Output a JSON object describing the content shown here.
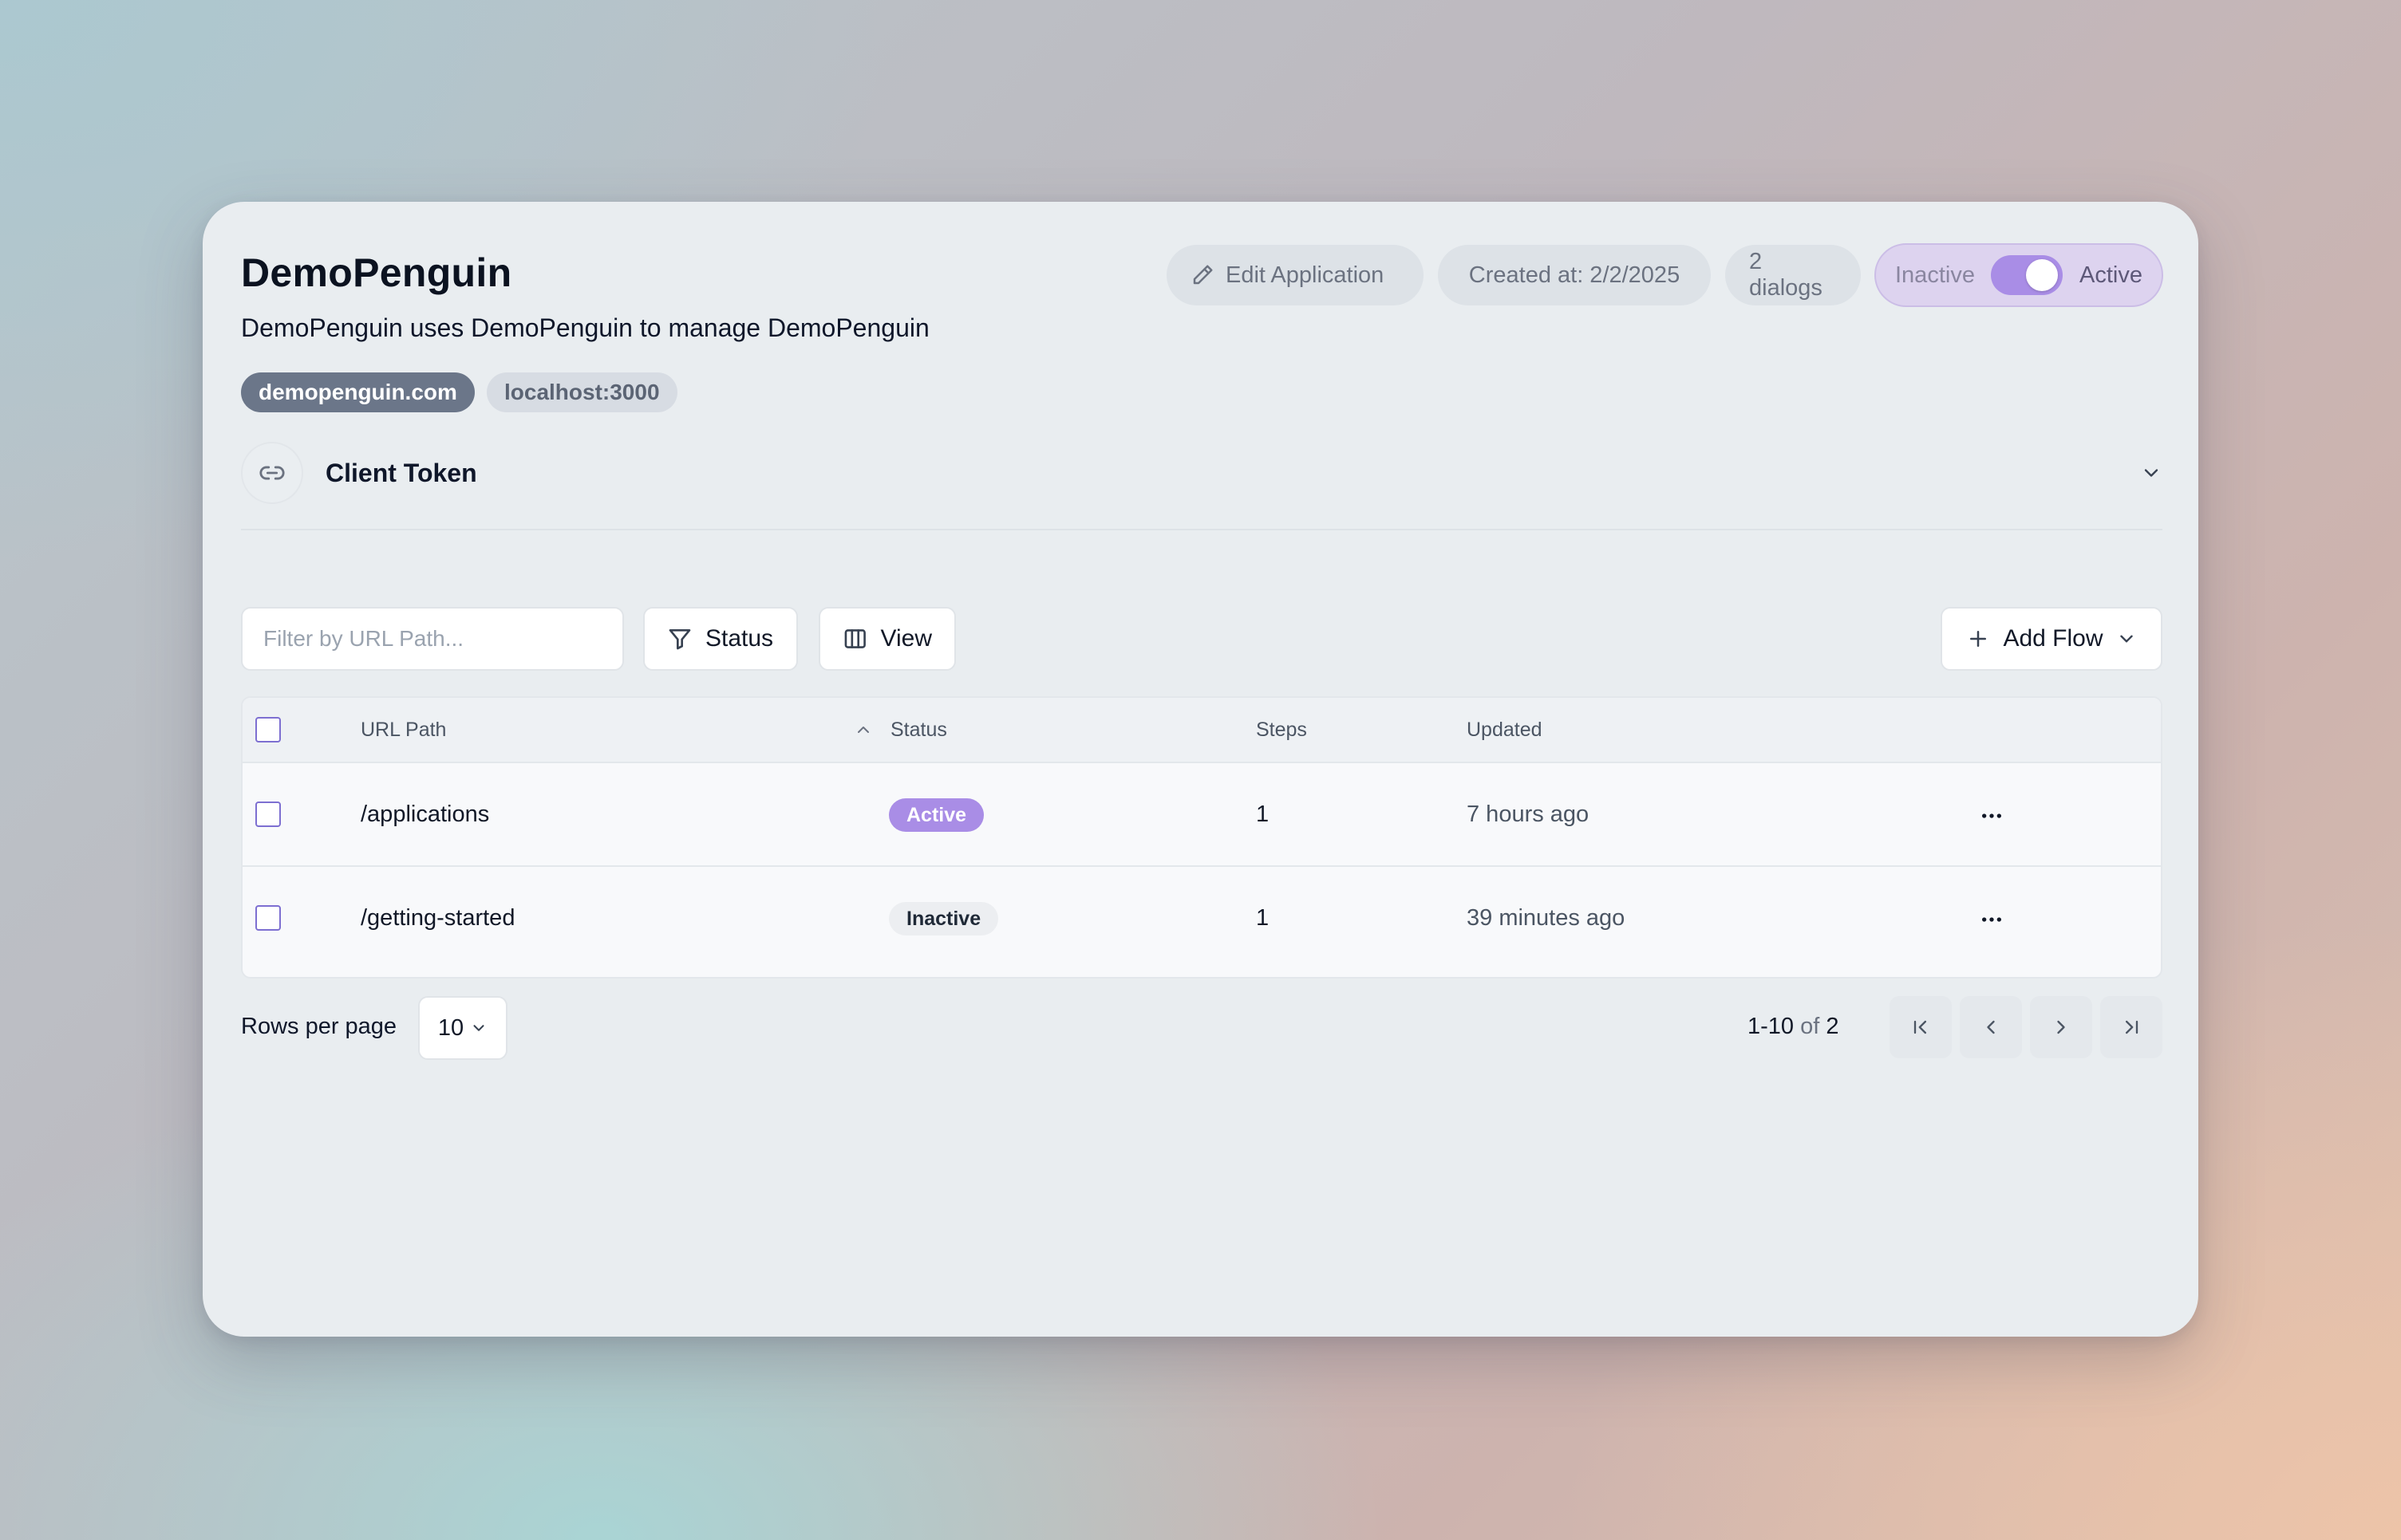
{
  "app": {
    "title": "DemoPenguin",
    "description": "DemoPenguin uses DemoPenguin to manage DemoPenguin"
  },
  "domains": [
    "demopenguin.com",
    "localhost:3000"
  ],
  "header": {
    "edit_label": "Edit Application",
    "created": "Created at: 2/2/2025",
    "dialogs": "2 dialogs",
    "toggle_inactive": "Inactive",
    "toggle_active": "Active",
    "toggle_state": "active"
  },
  "token": {
    "label": "Client Token"
  },
  "toolbar": {
    "filter_placeholder": "Filter by URL Path...",
    "filter_value": "",
    "status_label": "Status",
    "view_label": "View",
    "add_label": "Add Flow"
  },
  "table": {
    "columns": [
      "URL Path",
      "Status",
      "Steps",
      "Updated"
    ],
    "rows": [
      {
        "path": "/applications",
        "status": "Active",
        "steps": "1",
        "updated": "7 hours ago"
      },
      {
        "path": "/getting-started",
        "status": "Inactive",
        "steps": "1",
        "updated": "39 minutes ago"
      }
    ]
  },
  "pagination": {
    "rows_label": "Rows per page",
    "rows_value": "10",
    "range": "1-10",
    "of_label": "of",
    "total": "2"
  },
  "colors": {
    "accent": "#a98de6",
    "chip_dark": "#6b7689",
    "card_bg": "#e9edf0"
  }
}
